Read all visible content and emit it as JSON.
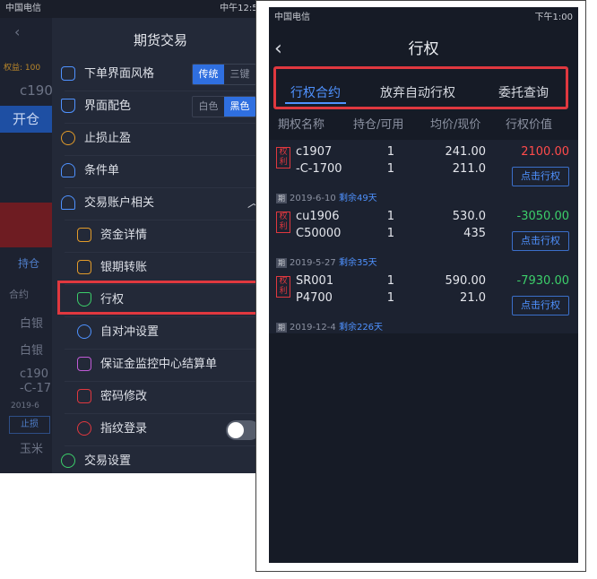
{
  "left_status": {
    "carrier": "中国电信",
    "time": "中午12:59"
  },
  "left_bg": {
    "value": "权益: 100",
    "contract": "c190",
    "open_btn": "开仓",
    "tab": "持仓",
    "col": "合约",
    "rows": [
      "白银",
      "白银",
      "c190",
      "-C-17"
    ],
    "date": "2019-6",
    "stop_btn": "止损",
    "bottom": "玉米"
  },
  "menu": {
    "title": "期货交易",
    "style_label": "下单界面风格",
    "style_opts": [
      "传统",
      "三键"
    ],
    "color_label": "界面配色",
    "color_opts": [
      "白色",
      "黑色"
    ],
    "stop_label": "止损止盈",
    "cond_label": "条件单",
    "account_label": "交易账户相关",
    "funds_label": "资金详情",
    "transfer_label": "银期转账",
    "exercise_label": "行权",
    "hedge_label": "自对冲设置",
    "margin_label": "保证金监控中心结算单",
    "pwd_label": "密码修改",
    "finger_label": "指纹登录",
    "settings_label": "交易设置"
  },
  "right_status": {
    "carrier": "中国电信",
    "time": "下午1:00"
  },
  "right": {
    "title": "行权",
    "tabs": [
      "行权合约",
      "放弃自动行权",
      "委托查询"
    ],
    "headers": [
      "期权名称",
      "持仓/可用",
      "均价/现价",
      "行权价值"
    ],
    "rows": [
      {
        "tag": "权利",
        "name1": "c1907",
        "name2": "-C-1700",
        "hold": "1",
        "avail": "1",
        "avg": "241.00",
        "cur": "211.0",
        "value": "2100.00",
        "value_color": "#ff4b4b",
        "btn": "点击行权",
        "date": "2019-6-10",
        "remain": "剩余49天"
      },
      {
        "tag": "权利",
        "name1": "cu1906",
        "name2": "C50000",
        "hold": "1",
        "avail": "1",
        "avg": "530.0",
        "cur": "435",
        "value": "-3050.00",
        "value_color": "#3ccf6a",
        "btn": "点击行权",
        "date": "2019-5-27",
        "remain": "剩余35天"
      },
      {
        "tag": "权利",
        "name1": "SR001",
        "name2": "P4700",
        "hold": "1",
        "avail": "1",
        "avg": "590.00",
        "cur": "21.0",
        "value": "-7930.00",
        "value_color": "#3ccf6a",
        "btn": "点击行权",
        "date": "2019-12-4",
        "remain": "剩余226天"
      }
    ]
  },
  "colors": {
    "accent": "#4f92ff",
    "highlight": "#e0383f",
    "profit": "#ff4b4b",
    "loss": "#3ccf6a"
  }
}
